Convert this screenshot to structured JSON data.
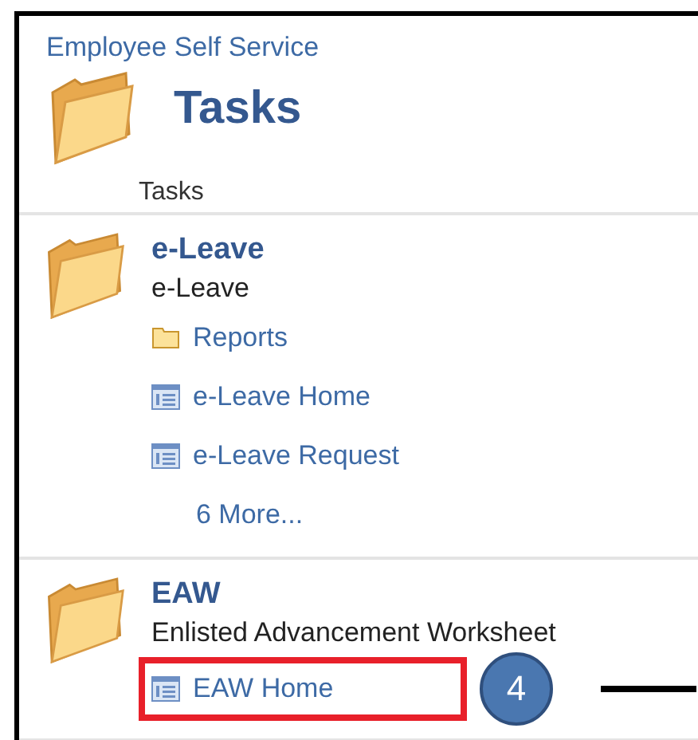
{
  "header": "Employee Self Service",
  "title": "Tasks",
  "subtitle": "Tasks",
  "sections": [
    {
      "title": "e-Leave",
      "description": "e-Leave",
      "links": [
        {
          "kind": "folder",
          "label": "Reports",
          "highlighted": false
        },
        {
          "kind": "page",
          "label": "e-Leave Home",
          "highlighted": false
        },
        {
          "kind": "page",
          "label": "e-Leave Request",
          "highlighted": false
        },
        {
          "kind": "more",
          "label": "6 More...",
          "highlighted": false
        }
      ]
    },
    {
      "title": "EAW",
      "description": "Enlisted Advancement Worksheet",
      "links": [
        {
          "kind": "page",
          "label": "EAW Home",
          "highlighted": true
        }
      ]
    }
  ],
  "callout": {
    "number": "4"
  }
}
